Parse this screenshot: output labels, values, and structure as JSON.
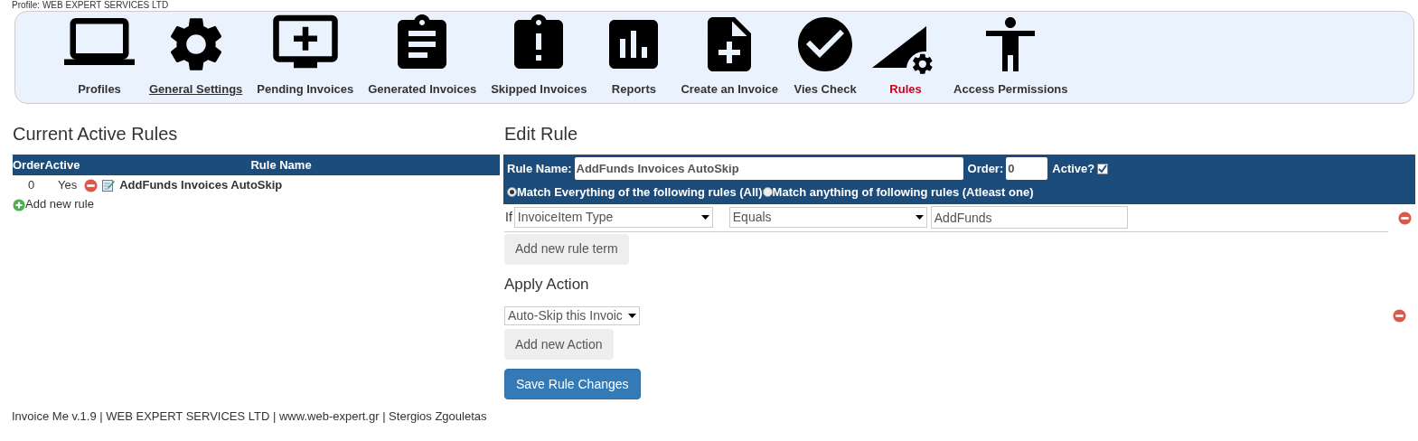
{
  "profile_line": "Profile: WEB EXPERT SERVICES LTD",
  "nav": [
    {
      "label": "Profiles",
      "selected": false,
      "underlined": false
    },
    {
      "label": "General Settings",
      "selected": false,
      "underlined": true
    },
    {
      "label": "Pending Invoices",
      "selected": false,
      "underlined": false
    },
    {
      "label": "Generated Invoices",
      "selected": false,
      "underlined": false
    },
    {
      "label": "Skipped Invoices",
      "selected": false,
      "underlined": false
    },
    {
      "label": "Reports",
      "selected": false,
      "underlined": false
    },
    {
      "label": "Create an Invoice",
      "selected": false,
      "underlined": false
    },
    {
      "label": "Vies Check",
      "selected": false,
      "underlined": false
    },
    {
      "label": "Rules",
      "selected": true,
      "underlined": false
    },
    {
      "label": "Access Permissions",
      "selected": false,
      "underlined": false
    }
  ],
  "rules_list": {
    "title": "Current Active Rules",
    "columns": [
      "Order",
      "Active",
      "Rule Name"
    ],
    "rows": [
      {
        "order": "0",
        "active": "Yes",
        "name": "AddFunds Invoices AutoSkip"
      }
    ],
    "add_link": "Add new rule"
  },
  "edit_rule": {
    "title": "Edit Rule",
    "name_label": "Rule Name:",
    "name_value": "AddFunds Invoices AutoSkip",
    "order_label": "Order:",
    "order_value": "0",
    "active_label": "Active?",
    "active_checked": true,
    "match_options": [
      {
        "label": "Match Everything of the following rules (All)",
        "selected": true
      },
      {
        "label": "Match anything of following rules (Atleast one)",
        "selected": false
      }
    ],
    "terms": [
      {
        "prefix": "If",
        "field": "InvoiceItem Type",
        "operator": "Equals",
        "value": "AddFunds"
      }
    ],
    "add_term_button": "Add new rule term",
    "action_title": "Apply Action",
    "actions": [
      {
        "value": "Auto-Skip this Invoic"
      }
    ],
    "add_action_button": "Add new Action",
    "save_button": "Save Rule Changes"
  },
  "footer": "Invoice Me v.1.9 | WEB EXPERT SERVICES LTD | www.web-expert.gr | Stergios Zgouletas"
}
